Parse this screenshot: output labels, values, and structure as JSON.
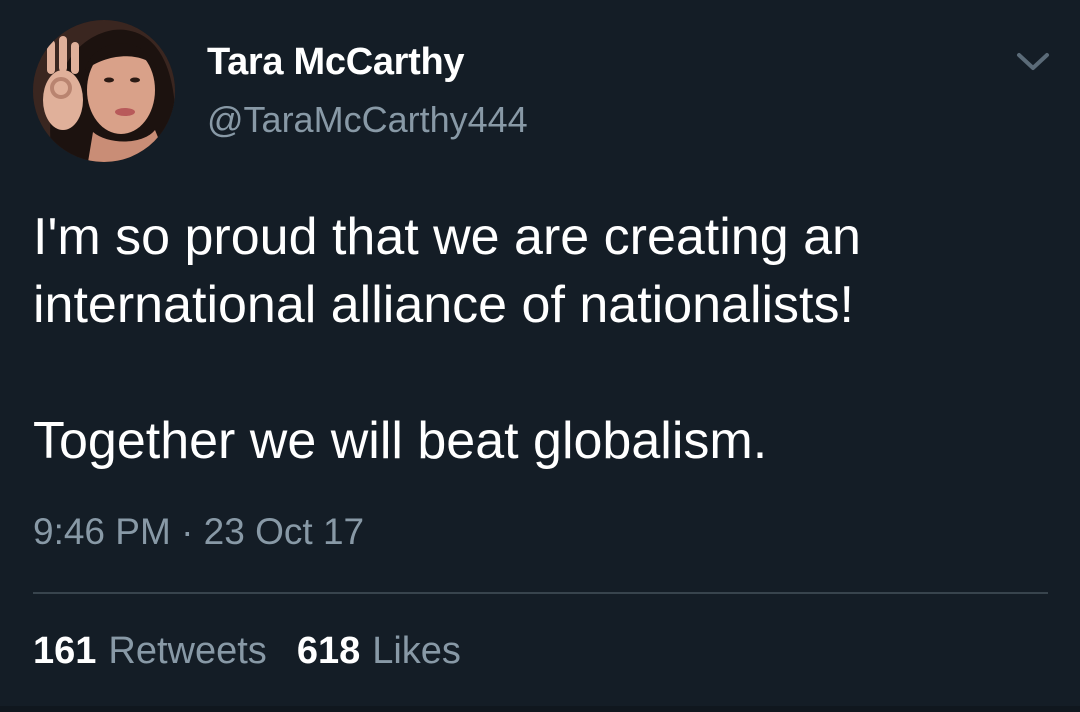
{
  "author": {
    "display_name": "Tara McCarthy",
    "handle": "@TaraMcCarthy444"
  },
  "tweet": {
    "lines": [
      "I'm so proud that we are creating an",
      "international alliance of nationalists!",
      "Together we will beat globalism."
    ],
    "timestamp": "9:46 PM · 23 Oct 17"
  },
  "stats": {
    "retweets_count": "161",
    "retweets_label": "Retweets",
    "likes_count": "618",
    "likes_label": "Likes"
  },
  "icons": {
    "menu": "chevron-down-icon"
  },
  "colors": {
    "background": "#141d26",
    "primary_text": "#ffffff",
    "secondary_text": "#8899a6",
    "divider": "#38444d"
  }
}
